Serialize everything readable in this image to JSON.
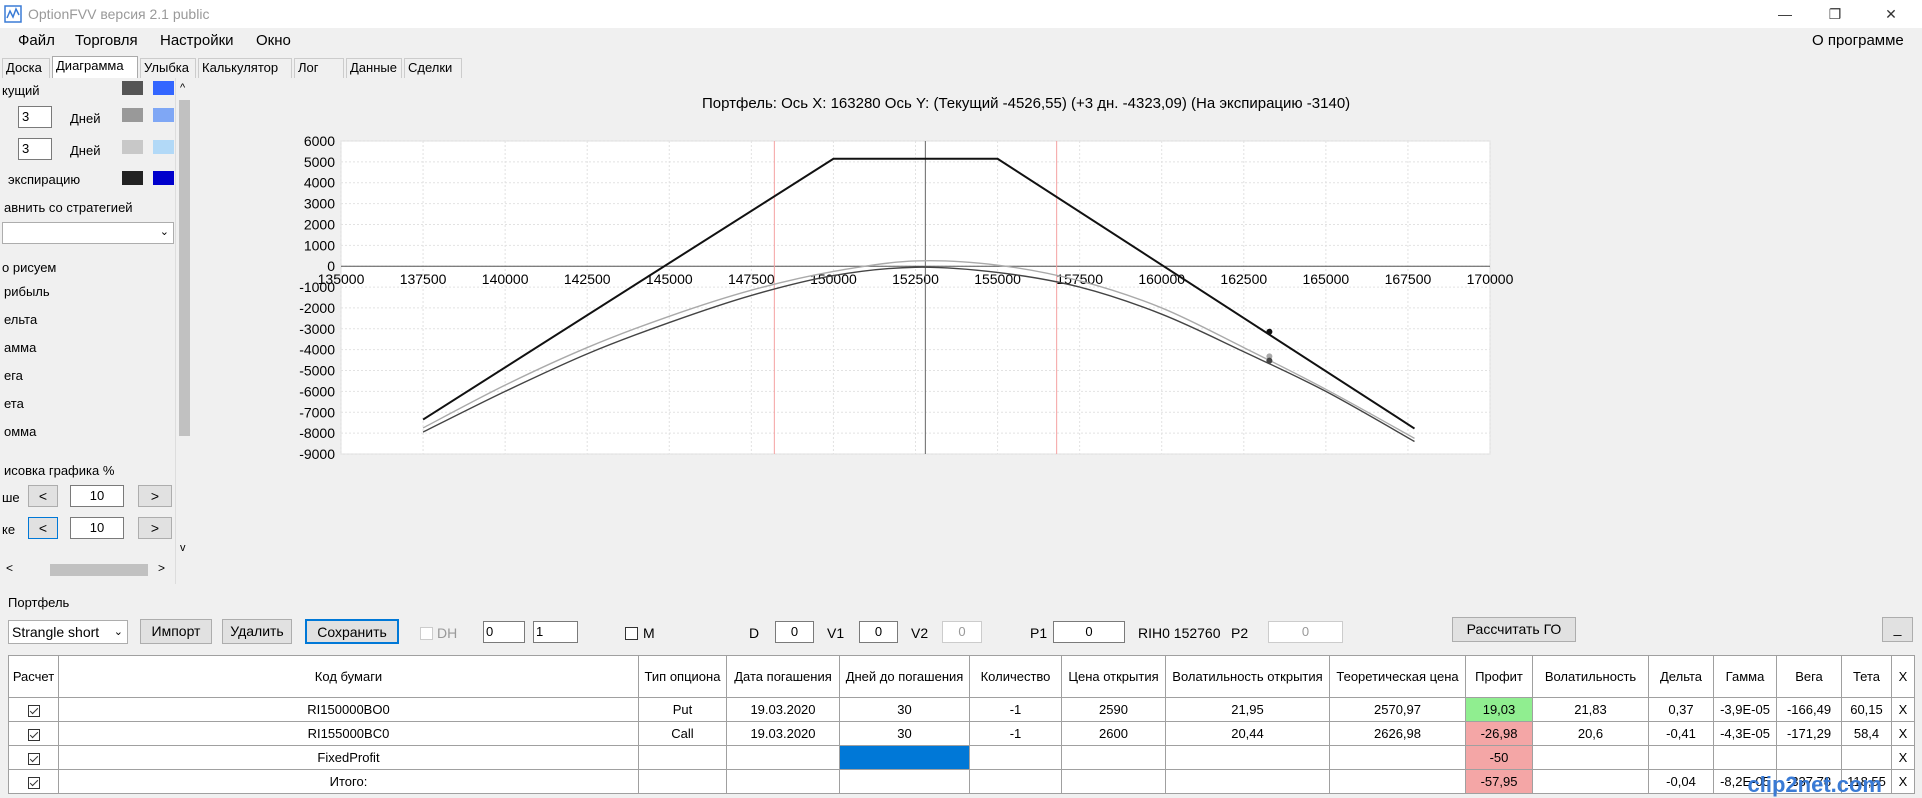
{
  "window": {
    "title": "OptionFVV версия 2.1 public",
    "minimize": "—",
    "restore": "❐",
    "close": "✕"
  },
  "menu": {
    "items": [
      "Файл",
      "Торговля",
      "Настройки",
      "Окно"
    ],
    "about": "О программе"
  },
  "tabs": [
    "Доска",
    "Диаграмма",
    "Улыбка",
    "Калькулятор",
    "Лог",
    "Данные",
    "Сделки"
  ],
  "active_tab": "Диаграмма",
  "left_panel": {
    "current_label": "кущий",
    "days1": "3",
    "days_label1": "Дней",
    "days2": "3",
    "days_label2": "Дней",
    "expiration_label": "экспирацию",
    "compare_label": "авнить со стратегией",
    "compare_value": "",
    "draw_label": "о рисуем",
    "options": [
      "рибыль",
      "ельта",
      "амма",
      "ега",
      "ета",
      "омма"
    ],
    "scale_label": "исовка графика %",
    "upper_label": "ше",
    "upper_prev": "<",
    "upper_value": "10",
    "upper_next": ">",
    "lower_label": "ке",
    "lower_prev": "<",
    "lower_value": "10",
    "lower_next": ">",
    "hscroll_left": "<",
    "hscroll_right": ">",
    "vscroll_up": "^",
    "vscroll_down": "v",
    "colors": {
      "current": [
        "#555555",
        "#3366ff"
      ],
      "days1": [
        "#999999",
        "#7fa7f5"
      ],
      "days2": [
        "#c8c8c8",
        "#b2d9f7"
      ],
      "expiration": [
        "#222222",
        "#0000cc"
      ]
    }
  },
  "chart_data": {
    "type": "line",
    "title": "Портфель: Ось X: 163280 Ось Y:  (Текущий -4526,55)  (+3 дн. -4323,09)  (На экспирацию -3140)",
    "xlim": [
      135000,
      170000
    ],
    "ylim": [
      -9000,
      6000
    ],
    "x_ticks": [
      "135000",
      "137500",
      "140000",
      "142500",
      "145000",
      "147500",
      "150000",
      "152500",
      "155000",
      "157500",
      "160000",
      "162500",
      "165000",
      "167500",
      "170000"
    ],
    "y_ticks": [
      "6000",
      "5000",
      "4000",
      "3000",
      "2000",
      "1000",
      "0",
      "-1000",
      "-2000",
      "-3000",
      "-4000",
      "-5000",
      "-6000",
      "-7000",
      "-8000",
      "-9000"
    ],
    "vlines": {
      "cursor": 152800,
      "red": [
        148200,
        156800
      ]
    },
    "series": [
      {
        "key": "expiration",
        "color": "#111111",
        "x": [
          137500,
          150000,
          155000,
          167700
        ],
        "y": [
          -7350,
          5150,
          5150,
          -7780
        ]
      },
      {
        "key": "plus3",
        "color": "#aaaaaa",
        "x": [
          137500,
          140000,
          142500,
          145000,
          147500,
          150000,
          152500,
          155000,
          157500,
          160000,
          162500,
          165000,
          167700
        ],
        "y": [
          -7750,
          -5700,
          -3900,
          -2400,
          -1150,
          -250,
          250,
          50,
          -700,
          -2000,
          -3900,
          -5900,
          -8250
        ]
      },
      {
        "key": "current",
        "color": "#444444",
        "x": [
          137500,
          140000,
          142500,
          145000,
          147500,
          150000,
          152500,
          155000,
          157500,
          160000,
          162500,
          165000,
          167700
        ],
        "y": [
          -7950,
          -6000,
          -4200,
          -2700,
          -1400,
          -450,
          -50,
          -300,
          -1000,
          -2300,
          -4100,
          -6000,
          -8400
        ]
      }
    ],
    "markers": [
      {
        "x": 163280,
        "y": -3140,
        "color": "#111111"
      },
      {
        "x": 163280,
        "y": -4323,
        "color": "#aaaaaa"
      },
      {
        "x": 163280,
        "y": -4526,
        "color": "#444444"
      }
    ]
  },
  "portfolio": {
    "label": "Портфель",
    "strategy": "Strangle short",
    "import": "Импорт",
    "delete": "Удалить",
    "save": "Сохранить",
    "dh_label": "DH",
    "spin1": "0",
    "spin2": "1",
    "m_label": "M",
    "d_label": "D",
    "d_value": "0",
    "v1_label": "V1",
    "v1_value": "0",
    "v2_label": "V2",
    "v2_value": "0",
    "p1_label": "P1",
    "p1_value": "0",
    "underlying": "RIH0 152760",
    "p2_label": "P2",
    "p2_value": "0",
    "calc_go": "Рассчитать ГО",
    "minimize": "_"
  },
  "table": {
    "headers": [
      "Расчет",
      "Код бумаги",
      "Тип опциона",
      "Дата погашения",
      "Дней до погашения",
      "Количество",
      "Цена открытия",
      "Волатильность открытия",
      "Теоретическая цена",
      "Профит",
      "Волатильность",
      "Дельта",
      "Гамма",
      "Вега",
      "Тета",
      "X"
    ],
    "rows": [
      [
        "",
        "RI150000BO0",
        "Put",
        "19.03.2020",
        "30",
        "-1",
        "2590",
        "21,95",
        "2570,97",
        "19,03",
        "21,83",
        "0,37",
        "-3,9E-05",
        "-166,49",
        "60,15",
        "X"
      ],
      [
        "",
        "RI155000BC0",
        "Call",
        "19.03.2020",
        "30",
        "-1",
        "2600",
        "20,44",
        "2626,98",
        "-26,98",
        "20,6",
        "-0,41",
        "-4,3E-05",
        "-171,29",
        "58,4",
        "X"
      ],
      [
        "",
        "FixedProfit",
        "",
        "",
        "",
        "",
        "",
        "",
        "",
        "-50",
        "",
        "",
        "",
        "",
        "",
        "X"
      ],
      [
        "",
        "Итого:",
        "",
        "",
        "",
        "",
        "",
        "",
        "",
        "-57,95",
        "",
        "-0,04",
        "-8,2E-05",
        "-337,78",
        "118,55",
        "X"
      ]
    ]
  },
  "watermark": "clip2net.com"
}
